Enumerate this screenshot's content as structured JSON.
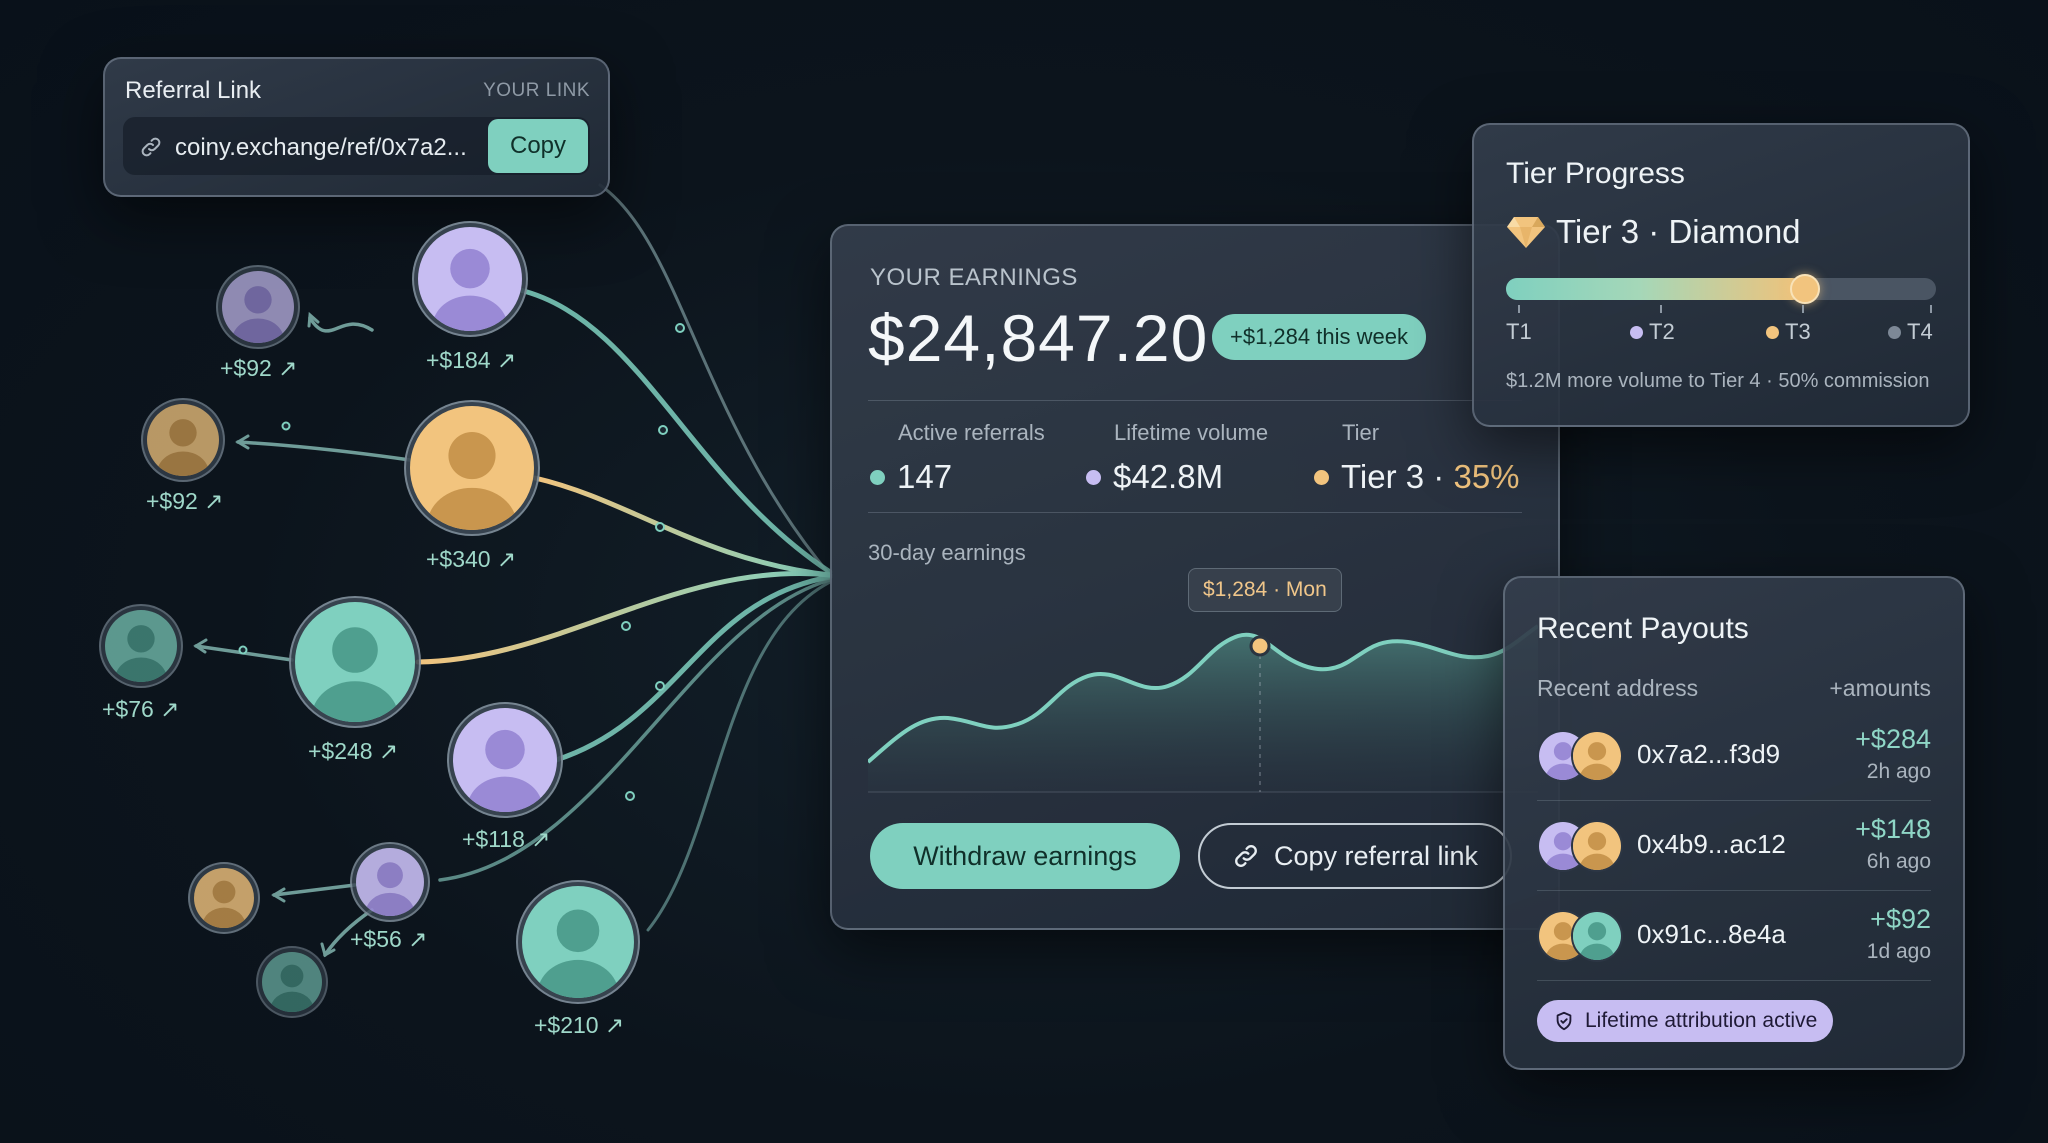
{
  "referral": {
    "title": "Referral Link",
    "caption": "YOUR LINK",
    "url": "coiny.exchange/ref/0x7a2...",
    "copy_label": "Copy",
    "icon": "link-icon"
  },
  "earnings": {
    "eyebrow": "YOUR EARNINGS",
    "amount": "$24,847.20",
    "weekly_pill": "+$1,284 this week",
    "stats": [
      {
        "label": "Active referrals",
        "value": "147",
        "color": "#7fd0bf"
      },
      {
        "label": "Lifetime volume",
        "value": "$42.8M",
        "color": "#c7bdf2"
      },
      {
        "label": "Tier",
        "value": "Tier 3 · ",
        "highlight": "35%",
        "color": "#f2c47e"
      }
    ],
    "chart_label": "30-day earnings",
    "tooltip": "$1,284 · Mon",
    "withdraw_label": "Withdraw earnings",
    "copy_link_label": "Copy referral link"
  },
  "tier": {
    "title": "Tier Progress",
    "current": "Tier 3 · Diamond",
    "icon": "diamond-icon",
    "progress": 0.69,
    "levels": [
      {
        "label": "T1",
        "color": ""
      },
      {
        "label": "T2",
        "color": "#c7bdf2"
      },
      {
        "label": "T3",
        "color": "#f2c47e"
      },
      {
        "label": "T4",
        "color": "#7d8896"
      }
    ],
    "note": "$1.2M more volume to Tier 4 · 50% commission"
  },
  "payouts": {
    "title": "Recent Payouts",
    "col_left": "Recent address",
    "col_right": "+amounts",
    "rows": [
      {
        "address": "0x7a2...f3d9",
        "amount": "+$284",
        "ago": "2h ago"
      },
      {
        "address": "0x4b9...ac12",
        "amount": "+$148",
        "ago": "6h ago"
      },
      {
        "address": "0x91c...8e4a",
        "amount": "+$92",
        "ago": "1d ago"
      }
    ],
    "badge": "Lifetime attribution active"
  },
  "network": {
    "earnings": [
      "+$184 ↗",
      "+$92 ↗",
      "+$92 ↗",
      "+$340 ↗",
      "+$76 ↗",
      "+$248 ↗",
      "+$118 ↗",
      "+$56 ↗",
      "+$210 ↗"
    ]
  },
  "colors": {
    "accent": "#7fd0bf",
    "gold": "#f2c47e",
    "lavender": "#c7bdf2",
    "bg": "#0c141c"
  }
}
